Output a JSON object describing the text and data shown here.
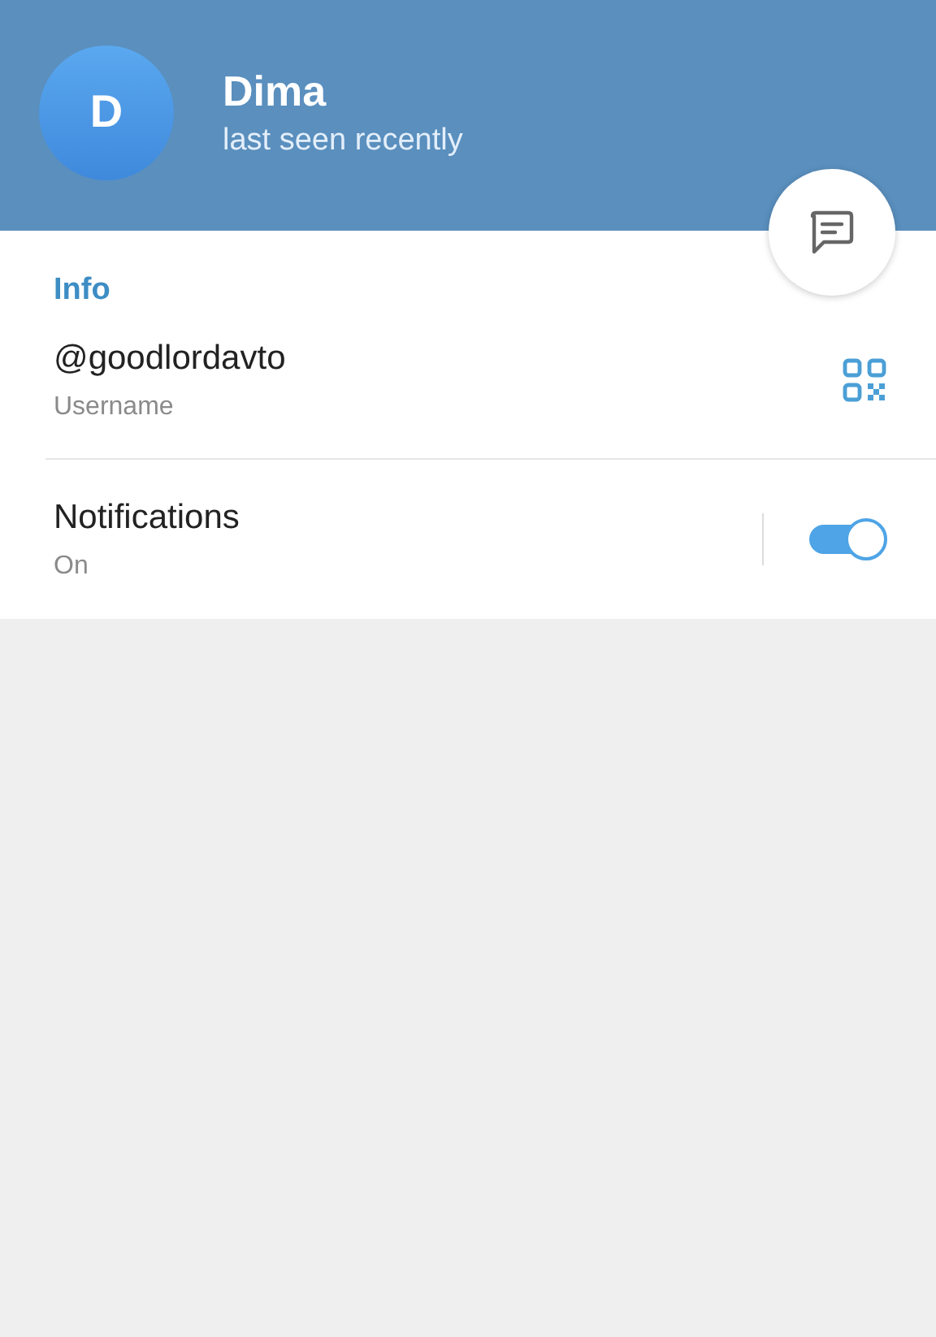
{
  "header": {
    "avatar_initial": "D",
    "name": "Dima",
    "status": "last seen recently"
  },
  "section_title": "Info",
  "username": {
    "value": "@goodlordavto",
    "label": "Username"
  },
  "notifications": {
    "title": "Notifications",
    "value": "On",
    "on": true
  }
}
